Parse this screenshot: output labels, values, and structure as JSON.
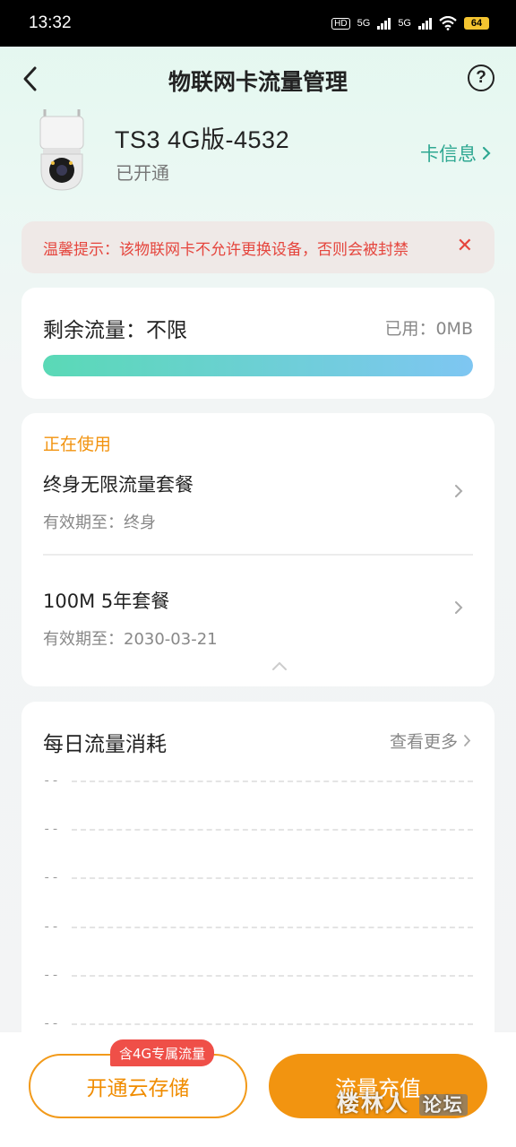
{
  "status_bar": {
    "time": "13:32",
    "hd": "HD",
    "net1": "5G",
    "net2": "5G",
    "battery": "64"
  },
  "header": {
    "title": "物联网卡流量管理",
    "back_icon": "chevron-left-icon",
    "help_icon": "question-circle-icon",
    "help_glyph": "?"
  },
  "device": {
    "name": "TS3  4G版-4532",
    "status": "已开通",
    "card_info_label": "卡信息"
  },
  "warning": {
    "text": "温馨提示：该物联网卡不允许更换设备，否则会被封禁",
    "close_glyph": "✕"
  },
  "traffic": {
    "remaining_label": "剩余流量：不限",
    "used_label": "已用：0MB",
    "fill_percent": 100,
    "colors": {
      "start": "#5ad9b6",
      "end": "#7ec6f2"
    }
  },
  "packages": {
    "section_label": "正在使用",
    "items": [
      {
        "name": "终身无限流量套餐",
        "expiry": "有效期至：终身"
      },
      {
        "name": "100M 5年套餐",
        "expiry": "有效期至：2030-03-21"
      }
    ]
  },
  "daily": {
    "title": "每日流量消耗",
    "more_label": "查看更多",
    "grid_labels": [
      "--",
      "--",
      "--",
      "--",
      "--",
      "--"
    ]
  },
  "bottom": {
    "cloud_button": "开通云存储",
    "cloud_badge": "含4G专属流量",
    "topup_button": "流量充值"
  },
  "watermark": {
    "text": "楼林人",
    "box": "论坛"
  },
  "colors": {
    "accent_orange": "#f29410",
    "accent_teal": "#2fa892",
    "warning_red": "#e5453d"
  }
}
